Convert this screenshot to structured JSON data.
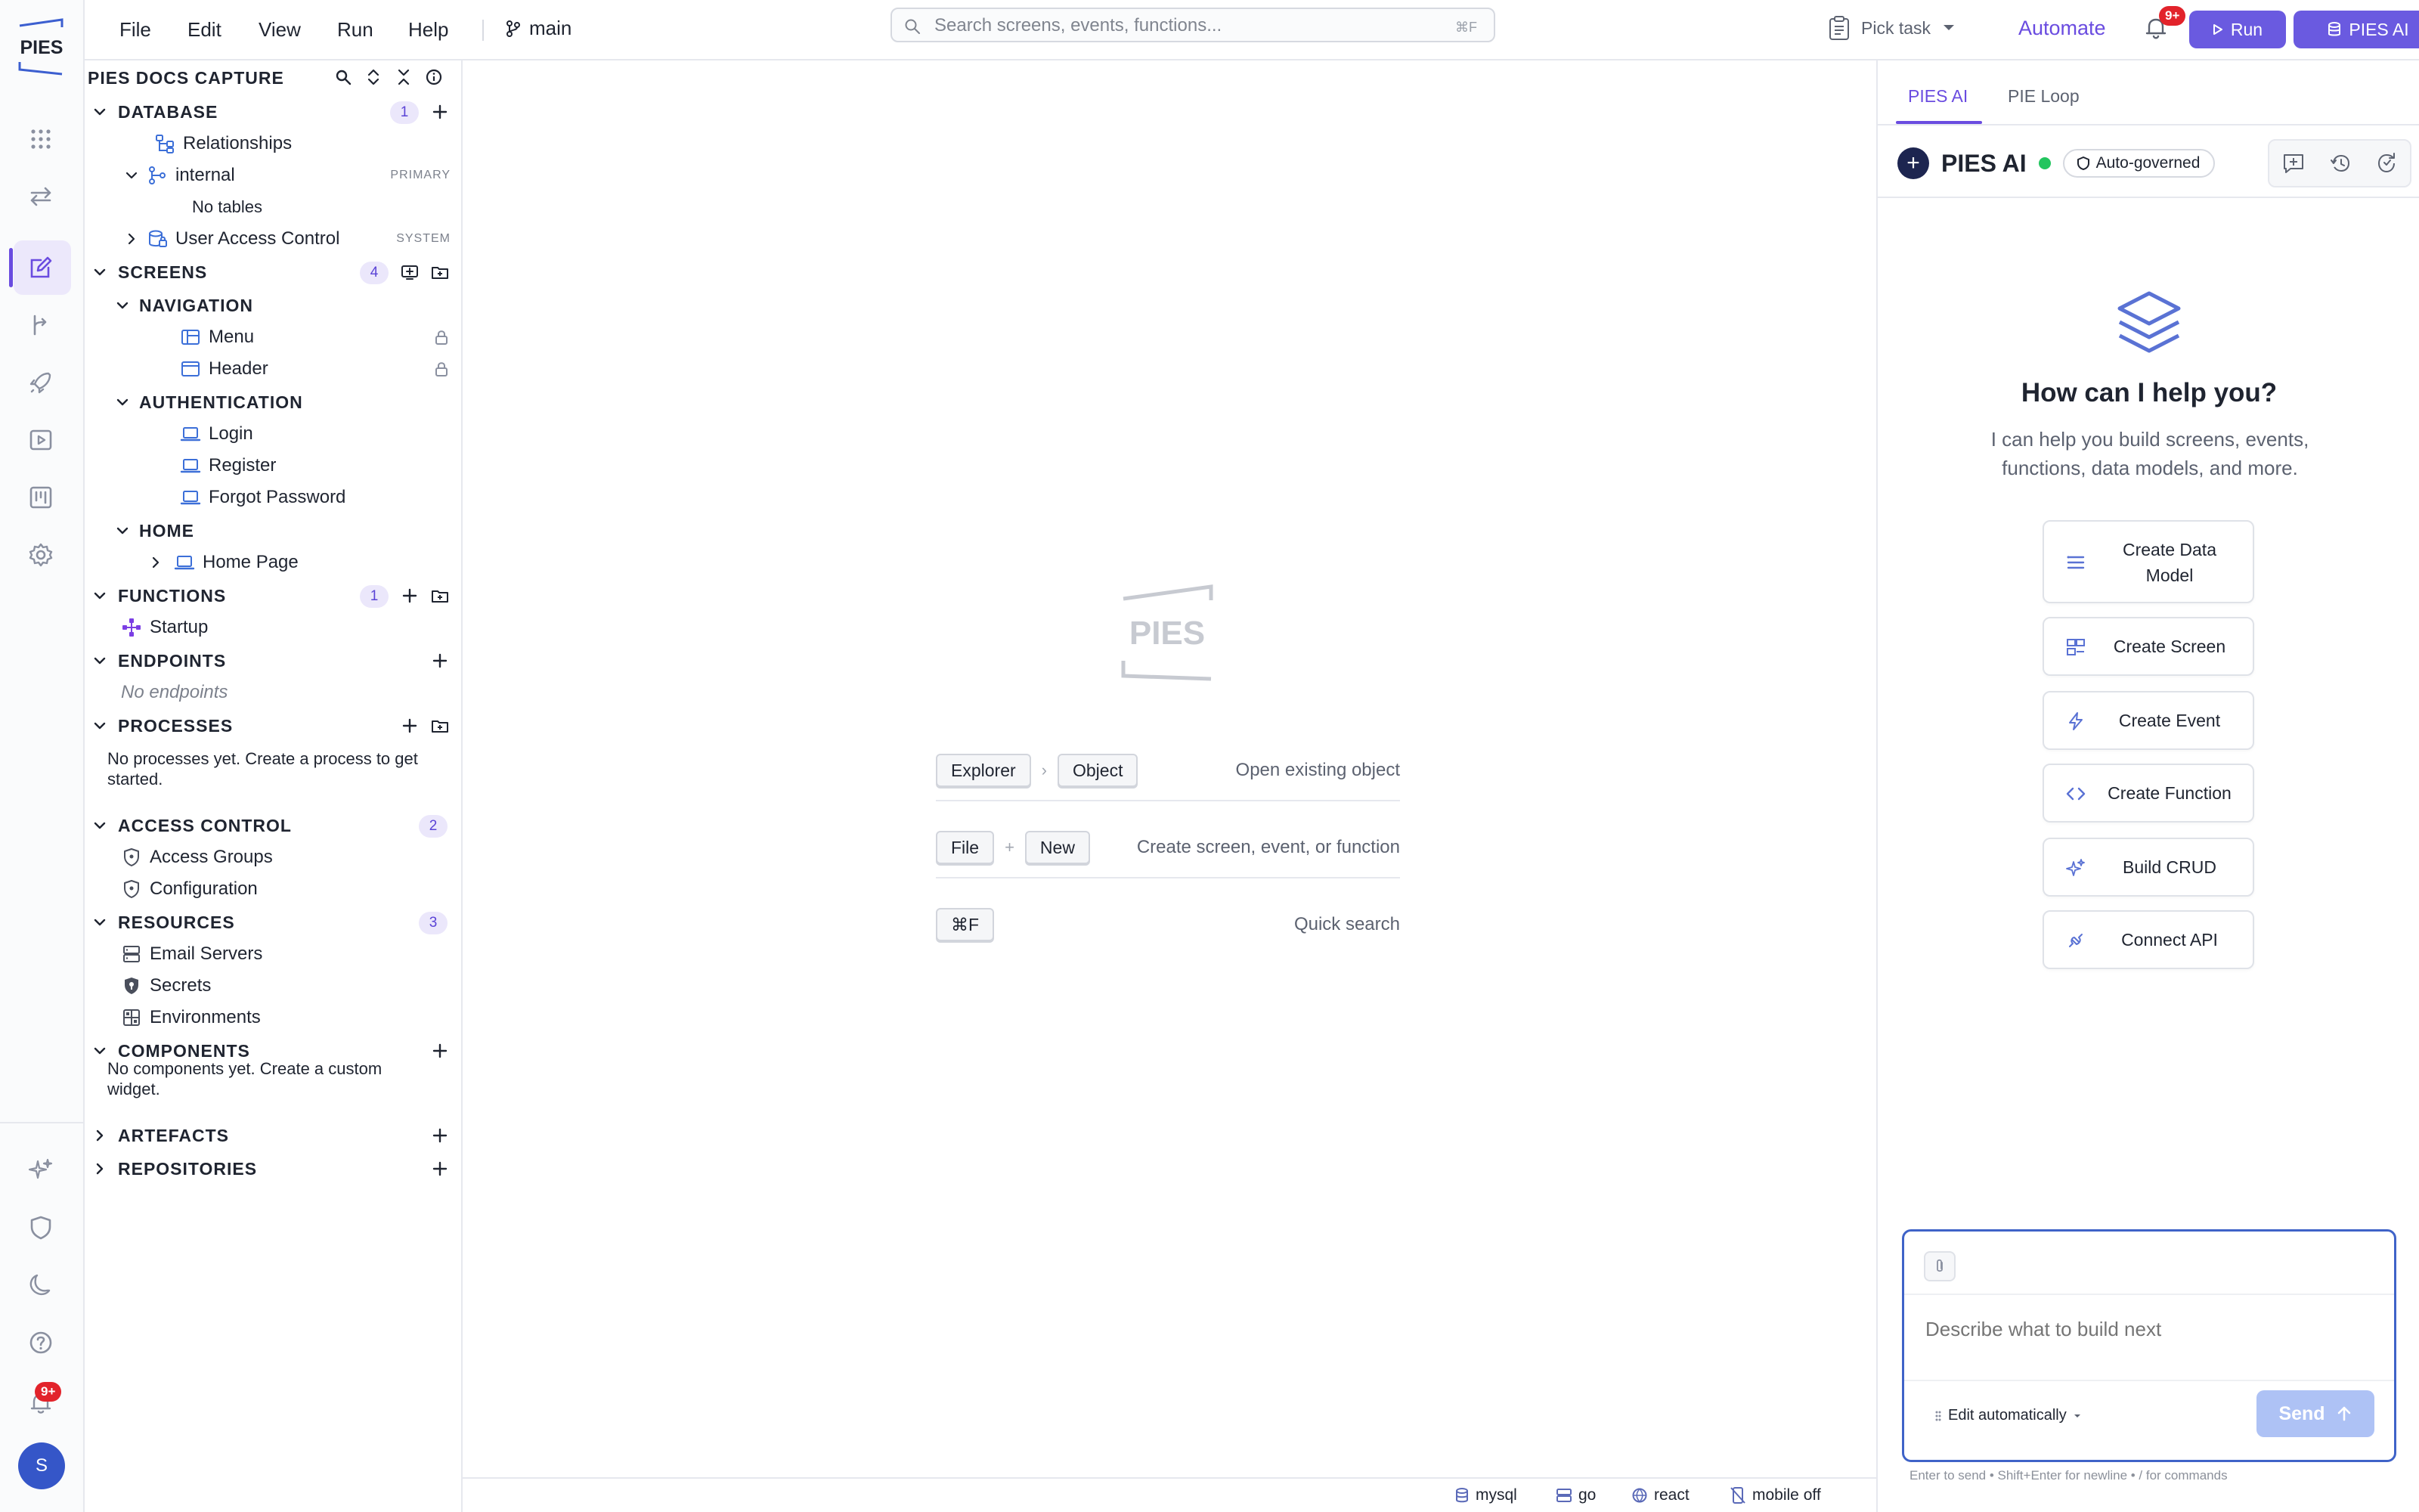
{
  "menu": {
    "file": "File",
    "edit": "Edit",
    "view": "View",
    "run": "Run",
    "help": "Help",
    "branch": "main"
  },
  "search": {
    "placeholder": "Search screens, events, functions...",
    "shortcut": "⌘F"
  },
  "header": {
    "pick_task": "Pick task",
    "automate": "Automate",
    "notification_badge": "9+",
    "run_label": "Run",
    "ai_label": "PIES AI"
  },
  "rail": {
    "logo_text": "PIES",
    "notification_badge": "9+",
    "avatar_initial": "S"
  },
  "explorer": {
    "title": "PIES DOCS CAPTURE",
    "database": {
      "label": "DATABASE",
      "count": "1",
      "relationships": "Relationships",
      "internal": "internal",
      "internal_tag": "PRIMARY",
      "no_tables": "No tables",
      "uac": "User Access Control",
      "uac_tag": "SYSTEM"
    },
    "screens": {
      "label": "SCREENS",
      "count": "4",
      "navigation": "NAVIGATION",
      "menu": "Menu",
      "header": "Header",
      "authentication": "AUTHENTICATION",
      "login": "Login",
      "register": "Register",
      "forgot": "Forgot Password",
      "home": "HOME",
      "home_page": "Home Page"
    },
    "functions": {
      "label": "FUNCTIONS",
      "count": "1",
      "startup": "Startup"
    },
    "endpoints": {
      "label": "ENDPOINTS",
      "empty": "No endpoints"
    },
    "processes": {
      "label": "PROCESSES",
      "empty": "No processes yet. Create a process to get started."
    },
    "access_control": {
      "label": "ACCESS CONTROL",
      "count": "2",
      "groups": "Access Groups",
      "configuration": "Configuration"
    },
    "resources": {
      "label": "RESOURCES",
      "count": "3",
      "email": "Email Servers",
      "secrets": "Secrets",
      "environments": "Environments"
    },
    "components": {
      "label": "COMPONENTS",
      "empty": "No components yet. Create a custom widget."
    },
    "artefacts": {
      "label": "ARTEFACTS"
    },
    "repositories": {
      "label": "REPOSITORIES"
    }
  },
  "center": {
    "logo_text": "PIES",
    "hints": [
      {
        "keys": [
          "Explorer",
          "Object"
        ],
        "sep": "›",
        "text": "Open existing object"
      },
      {
        "keys": [
          "File",
          "New"
        ],
        "sep": "+",
        "text": "Create screen, event, or function"
      },
      {
        "keys": [
          "⌘F"
        ],
        "sep": "",
        "text": "Quick search"
      }
    ]
  },
  "statusbar": {
    "db": "mysql",
    "backend": "go",
    "frontend": "react",
    "mobile": "mobile off"
  },
  "ai_panel": {
    "tabs": [
      "PIES AI",
      "PIE Loop"
    ],
    "title": "PIES AI",
    "governance": "Auto-governed",
    "help_title": "How can I help you?",
    "help_sub": "I can help you build screens, events, functions, data models, and more.",
    "actions": [
      "Create Data Model",
      "Create Screen",
      "Create Event",
      "Create Function",
      "Build CRUD",
      "Connect API"
    ],
    "composer_placeholder": "Describe what to build next",
    "edit_mode": "Edit automatically",
    "send_label": "Send",
    "composer_hint": "Enter to send • Shift+Enter for newline • / for commands"
  },
  "colors": {
    "accent": "#6a4ce0",
    "button": "#6a5ae0",
    "badge": "#e2232b",
    "online": "#22c55e",
    "focus": "#3f63c8"
  }
}
